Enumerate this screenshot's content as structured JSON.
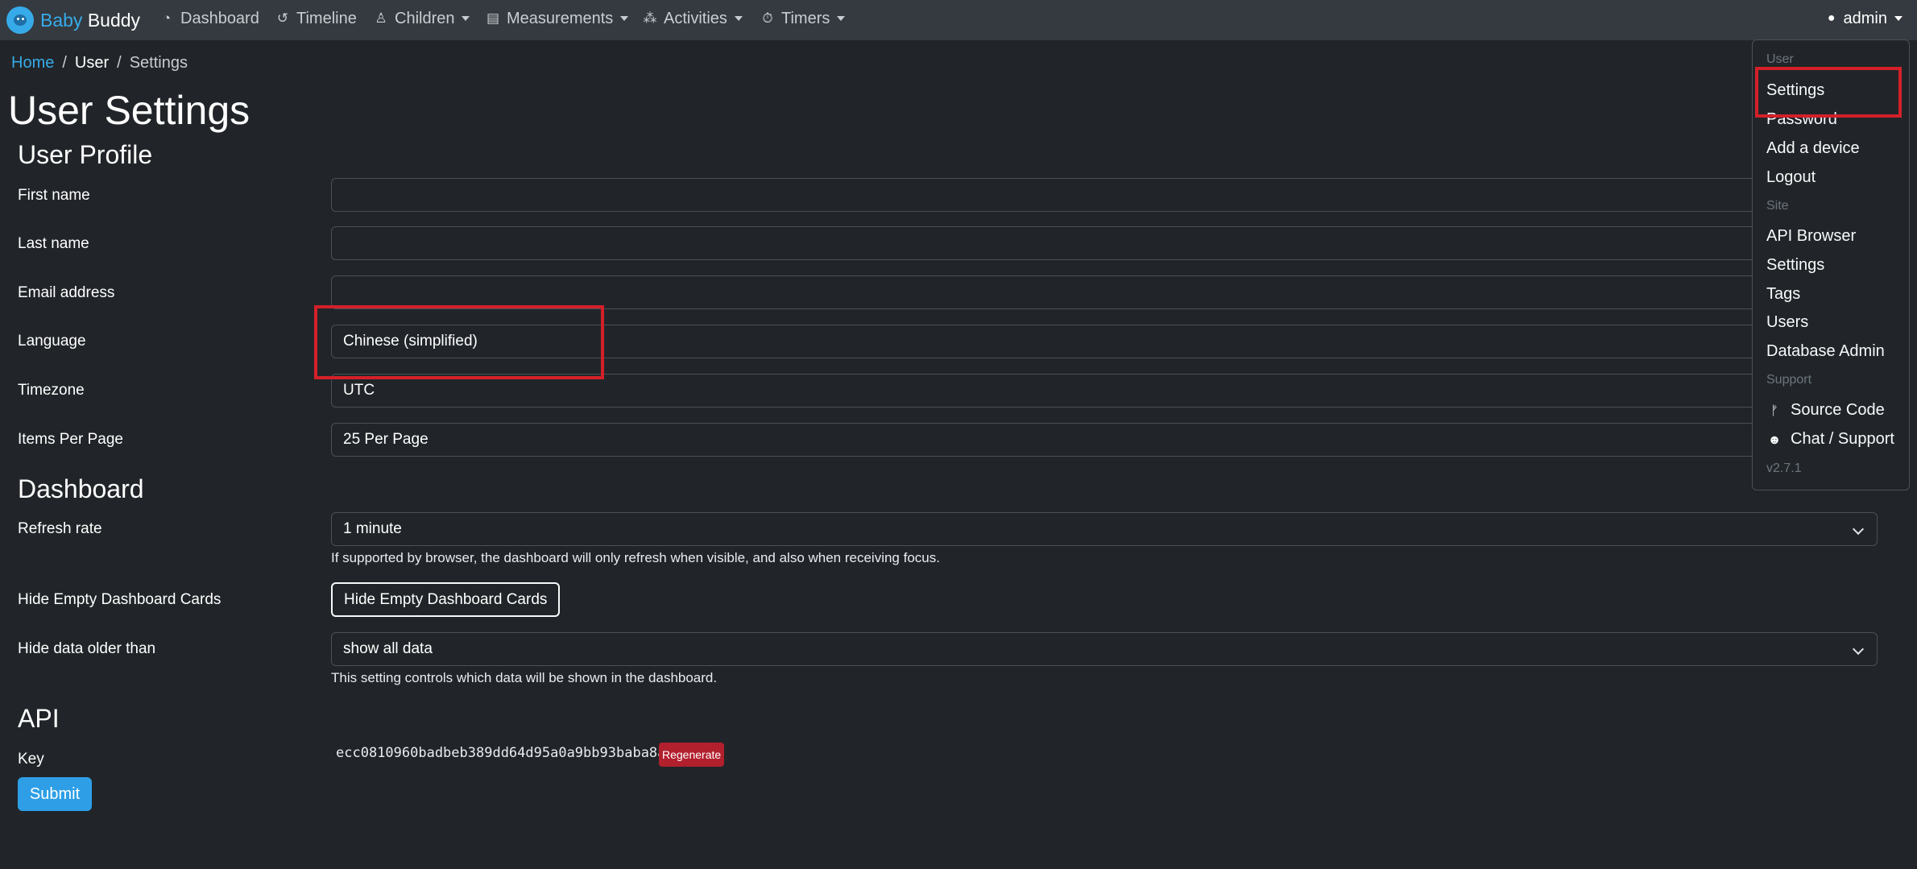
{
  "brand": {
    "part1": "Baby",
    "part2": "Buddy"
  },
  "nav": {
    "dashboard": "Dashboard",
    "timeline": "Timeline",
    "children": "Children",
    "measurements": "Measurements",
    "activities": "Activities",
    "timers": "Timers",
    "user": "admin"
  },
  "breadcrumb": {
    "home": "Home",
    "user": "User",
    "current": "Settings"
  },
  "page_title": "User Settings",
  "profile": {
    "title": "User Profile",
    "first_name_label": "First name",
    "first_name_value": "",
    "last_name_label": "Last name",
    "last_name_value": "",
    "email_label": "Email address",
    "email_value": "",
    "language_label": "Language",
    "language_value": "Chinese (simplified)",
    "timezone_label": "Timezone",
    "timezone_value": "UTC",
    "items_label": "Items Per Page",
    "items_value": "25 Per Page"
  },
  "dashboard": {
    "title": "Dashboard",
    "refresh_label": "Refresh rate",
    "refresh_value": "1 minute",
    "refresh_help": "If supported by browser, the dashboard will only refresh when visible, and also when receiving focus.",
    "hide_empty_label": "Hide Empty Dashboard Cards",
    "hide_empty_button": "Hide Empty Dashboard Cards",
    "hide_older_label": "Hide data older than",
    "hide_older_value": "show all data",
    "hide_older_help": "This setting controls which data will be shown in the dashboard."
  },
  "api": {
    "title": "API",
    "key_label": "Key",
    "key_value": "ecc0810960badbeb389dd64d95a0a9bb93baba8a",
    "regenerate": "Regenerate"
  },
  "submit": "Submit",
  "user_menu": {
    "user_header": "User",
    "settings": "Settings",
    "password": "Password",
    "add_device": "Add a device",
    "logout": "Logout",
    "site_header": "Site",
    "api_browser": "API Browser",
    "site_settings": "Settings",
    "tags": "Tags",
    "users": "Users",
    "database_admin": "Database Admin",
    "support_header": "Support",
    "source_code": "Source Code",
    "chat_support": "Chat / Support",
    "version": "v2.7.1"
  },
  "colors": {
    "accent": "#37abe9",
    "annotation": "#d3202a",
    "danger": "#b21f2d"
  }
}
